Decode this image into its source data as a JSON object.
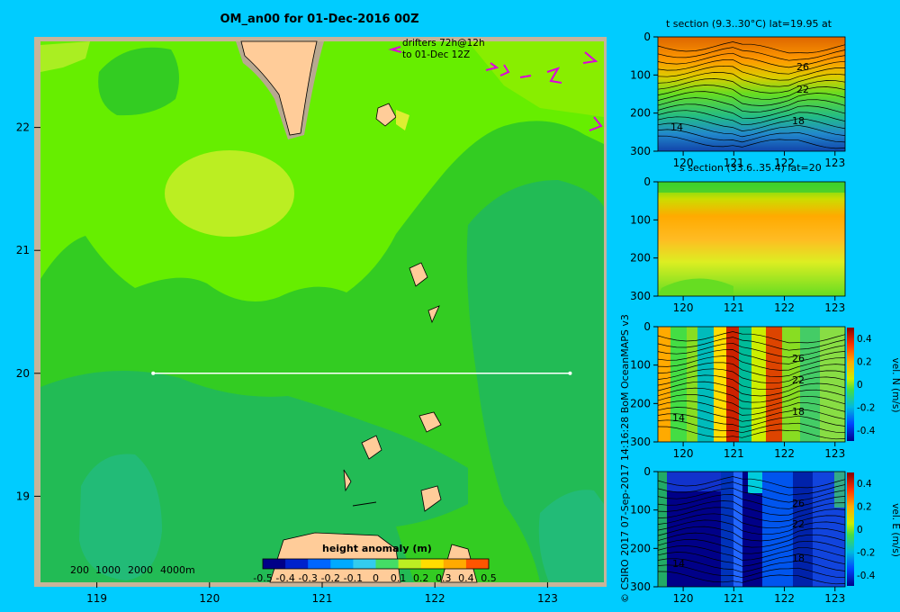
{
  "title": "OM_an00 for 01-Dec-2016 00Z",
  "credit": "© CSIRO 2017   07-Sep-2017 14:16:28 BoM OceanMAPS v3",
  "map": {
    "xticks": [
      "119",
      "120",
      "121",
      "122",
      "123"
    ],
    "yticks": [
      "22",
      "21",
      "20",
      "19"
    ],
    "drifter_note_line1": "drifters 72h@12h",
    "drifter_note_line2": "to 01-Dec 12Z",
    "depth_legend": [
      "200",
      "1000",
      "2000",
      "4000m"
    ],
    "section_line": {
      "lon_start": 119.5,
      "lon_end": 123.2,
      "lat": 20.0
    },
    "colorbar_title": "height anomaly (m)",
    "colorbar_ticks": [
      "-0.5",
      "-0.4",
      "-0.3",
      "-0.2",
      "-0.1",
      "0",
      "0.1",
      "0.2",
      "0.3",
      "0.4",
      "0.5"
    ]
  },
  "panels": {
    "t_section": {
      "title": "t section (9.3..30°C) lat=19.95 at",
      "contour_labels": [
        "26",
        "22",
        "18",
        "14"
      ]
    },
    "s_section": {
      "title": "s section (33.6..35.4) lat=20"
    },
    "v_section": {
      "cbar_label": "vel. N (m/s)",
      "contour_labels": [
        "26",
        "22",
        "18",
        "14"
      ]
    },
    "u_section": {
      "cbar_label": "vel. E (m/s)",
      "contour_labels": [
        "26",
        "22",
        "18",
        "14"
      ]
    },
    "xticks": [
      "120",
      "121",
      "122",
      "123"
    ],
    "yticks": [
      "0",
      "100",
      "200",
      "300"
    ],
    "cbar_ticks": [
      "0.4",
      "0.2",
      "0",
      "-0.2",
      "-0.4"
    ]
  },
  "chart_data": [
    {
      "type": "heatmap",
      "title": "OM_an00 for 01-Dec-2016 00Z",
      "xlim": [
        118.5,
        123.5
      ],
      "ylim": [
        18.3,
        22.7
      ],
      "colorbar_label": "height anomaly (m)",
      "colorbar_range": [
        -0.5,
        0.5
      ]
    },
    {
      "type": "heatmap",
      "title": "t section (9.3..30°C) lat=19.95 at",
      "xlim": [
        119.5,
        123.2
      ],
      "ylim": [
        300,
        0
      ],
      "contours": [
        26,
        22,
        18,
        14
      ]
    },
    {
      "type": "heatmap",
      "title": "s section (33.6..35.4) lat=20",
      "xlim": [
        119.5,
        123.2
      ],
      "ylim": [
        300,
        0
      ]
    },
    {
      "type": "heatmap",
      "colorbar_label": "vel. N (m/s)",
      "colorbar_range": [
        -0.4,
        0.4
      ],
      "xlim": [
        119.5,
        123.2
      ],
      "ylim": [
        300,
        0
      ]
    },
    {
      "type": "heatmap",
      "colorbar_label": "vel. E (m/s)",
      "colorbar_range": [
        -0.4,
        0.4
      ],
      "xlim": [
        119.5,
        123.2
      ],
      "ylim": [
        300,
        0
      ]
    }
  ]
}
